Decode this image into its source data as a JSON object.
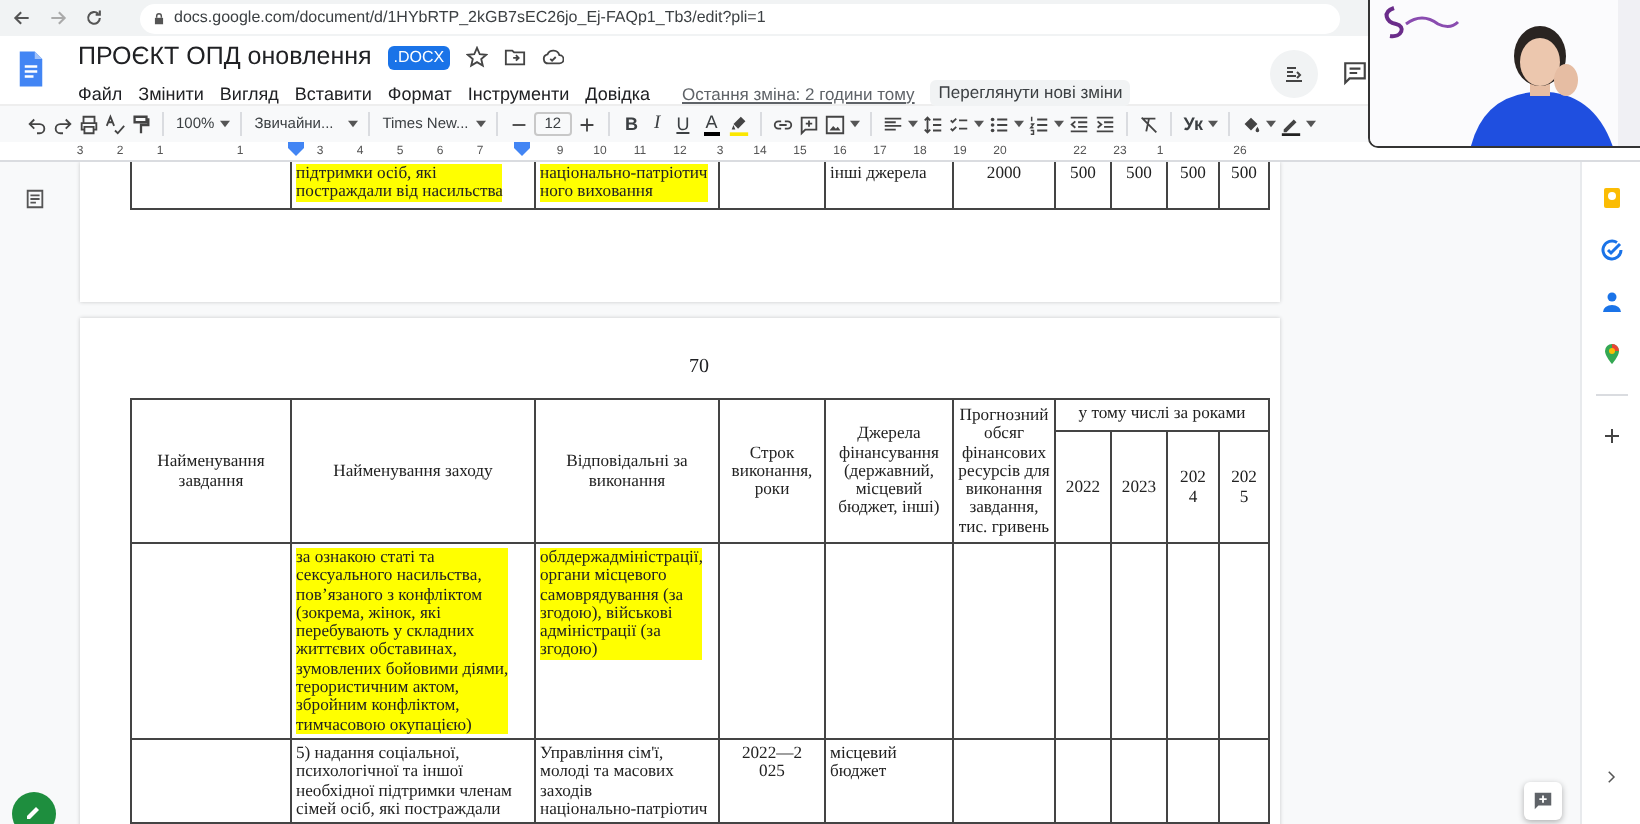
{
  "browser": {
    "url": "docs.google.com/document/d/1HYbRTP_2kGB7sEC26jo_Ej-FAQp1_Tb3/edit?pli=1"
  },
  "document": {
    "title": "ПРОЄКТ ОПД оновлення",
    "badge": ".DOCX"
  },
  "menu": [
    "Файл",
    "Змінити",
    "Вигляд",
    "Вставити",
    "Формат",
    "Інструменти",
    "Довідка"
  ],
  "last_edit": "Остання зміна: 2 години тому",
  "review_button": "Переглянути нові зміни",
  "toolbar": {
    "zoom": "100%",
    "style": "Звичайни...",
    "font": "Times New...",
    "font_size": "12",
    "format_buttons": [
      "B",
      "I",
      "U",
      "A"
    ],
    "input_tool": "Ук"
  },
  "ruler": {
    "ticks": [
      {
        "kind": "number",
        "label": "3"
      },
      {
        "kind": "number",
        "label": "2"
      },
      {
        "kind": "number",
        "label": "1"
      },
      {
        "kind": "blank"
      },
      {
        "kind": "number",
        "label": "1"
      },
      {
        "kind": "blank"
      },
      {
        "kind": "number",
        "label": "3"
      },
      {
        "kind": "number",
        "label": "4"
      },
      {
        "kind": "number",
        "label": "5"
      },
      {
        "kind": "number",
        "label": "6"
      },
      {
        "kind": "number",
        "label": "7"
      },
      {
        "kind": "blank"
      },
      {
        "kind": "number",
        "label": "9"
      },
      {
        "kind": "number",
        "label": "10"
      },
      {
        "kind": "number",
        "label": "11"
      },
      {
        "kind": "number",
        "label": "12"
      },
      {
        "kind": "number",
        "label": "3"
      },
      {
        "kind": "number",
        "label": "14"
      },
      {
        "kind": "number",
        "label": "15"
      },
      {
        "kind": "number",
        "label": "16"
      },
      {
        "kind": "number",
        "label": "17"
      },
      {
        "kind": "number",
        "label": "18"
      },
      {
        "kind": "number",
        "label": "19"
      },
      {
        "kind": "number",
        "label": "20"
      },
      {
        "kind": "blank"
      },
      {
        "kind": "number",
        "label": "22"
      },
      {
        "kind": "number",
        "label": "23"
      },
      {
        "kind": "number",
        "label": "1"
      },
      {
        "kind": "blank"
      },
      {
        "kind": "number",
        "label": "26"
      }
    ]
  },
  "pages": [
    {
      "rows": [
        {
          "cells": [
            {},
            {
              "text": "підтримки осіб, які\nпостраждали від насильства",
              "highlighted": true
            },
            {
              "text": "національно-патріотич\nного виховання",
              "highlighted": true
            },
            {},
            {
              "text": "інші джерела",
              "highlighted": false
            },
            {
              "text": "2000",
              "highlighted": false
            },
            {
              "text": "500",
              "highlighted": false
            },
            {
              "text": "500",
              "highlighted": false
            },
            {
              "text": "500",
              "highlighted": false
            },
            {
              "text": "500",
              "highlighted": false
            }
          ]
        }
      ]
    },
    {
      "page_number": "70",
      "header": {
        "columns": [
          "Найменування\nзавдання",
          "Найменування заходу",
          "Відповідальні за\nвиконання",
          "Строк\nвиконання,\nроки",
          "Джерела\nфінансування\n(державний,\nмісцевий\nбюджет, інші)",
          "Прогнозний\nобсяг\nфінансових\nресурсів для\nвиконання\nзавдання,\nтис. гривень"
        ],
        "group": "у тому числі за роками",
        "years": [
          "2022",
          "2023",
          "202\n4",
          "202\n5"
        ]
      },
      "rows": [
        {
          "cells": [
            {},
            {
              "text": "за ознакою статі та\nсексуального насильства,\nпов’язаного з конфліктом\n(зокрема, жінок, які\nперебувають у складних\nжиттєвих обставинах,\nзумовлених бойовими діями,\nтерористичним актом,\nзбройним конфліктом,\nтимчасовою окупацією)",
              "highlighted": true
            },
            {
              "text": "облдержадміністрації,\nоргани місцевого\nсамоврядування (за\nзгодою), військові\nадміністрації (за\nзгодою)",
              "highlighted": true
            },
            {},
            {},
            {},
            {},
            {},
            {},
            {}
          ]
        },
        {
          "cells": [
            {},
            {
              "text": "5) надання соціальної,\nпсихологічної та іншої\nнеобхідної підтримки членам\nсімей осіб, які постраждали",
              "highlighted": false
            },
            {
              "text": "Управління сім'ї,\nмолоді та масових\nзаходів\nнаціонально-патріотич",
              "highlighted": false
            },
            {
              "text": "2022—2\n025",
              "highlighted": false
            },
            {
              "text": "місцевий\nбюджет",
              "highlighted": false
            },
            {},
            {},
            {},
            {},
            {}
          ]
        }
      ]
    }
  ]
}
